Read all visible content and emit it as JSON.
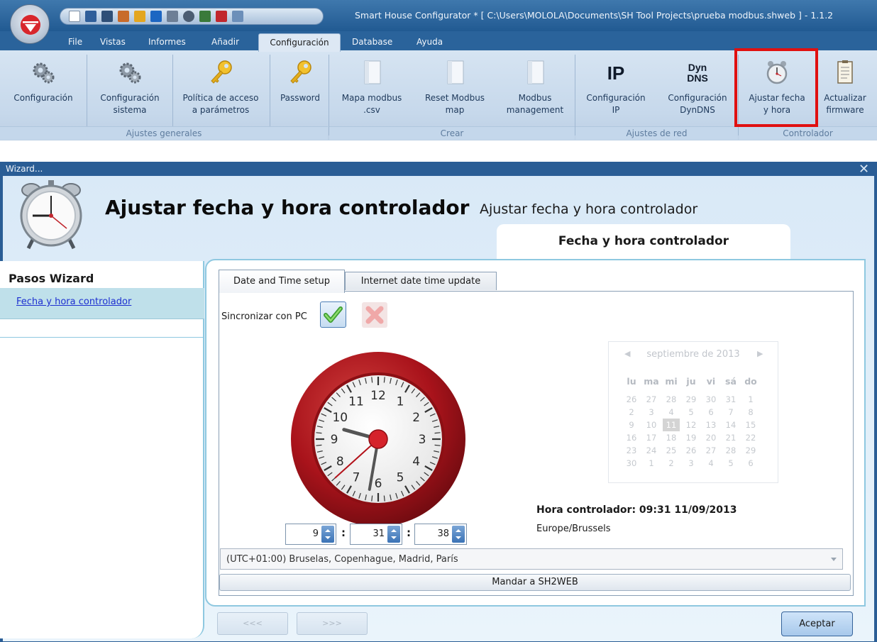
{
  "app": {
    "title": "Smart House Configurator * [ C:\\Users\\MOLOLA\\Documents\\SH Tool Projects\\prueba modbus.shweb ] - 1.1.2",
    "tabs": [
      "File",
      "Vistas",
      "Informes",
      "Añadir",
      "Configuración",
      "Database",
      "Ayuda"
    ],
    "active_tab": "Configuración"
  },
  "ribbon": {
    "items": [
      {
        "label1": "Configuración",
        "label2": "",
        "icon": "gears-icon"
      },
      {
        "label1": "Configuración",
        "label2": "sistema",
        "icon": "gears-icon"
      },
      {
        "label1": "Política de acceso",
        "label2": "a parámetros",
        "icon": "key-icon"
      },
      {
        "label1": "Password",
        "label2": "",
        "icon": "key-icon"
      },
      {
        "label1": "Mapa modbus",
        "label2": ".csv",
        "icon": "document-icon"
      },
      {
        "label1": "Reset Modbus",
        "label2": "map",
        "icon": "document-icon"
      },
      {
        "label1": "Modbus",
        "label2": "management",
        "icon": "document-icon"
      },
      {
        "label1": "Configuración",
        "label2": "IP",
        "icon": "ip-icon"
      },
      {
        "label1": "Configuración",
        "label2": "DynDNS",
        "icon": "dyndns-icon"
      },
      {
        "label1": "Ajustar fecha",
        "label2": "y hora",
        "icon": "alarm-clock-icon"
      },
      {
        "label1": "Actualizar",
        "label2": "firmware",
        "icon": "clipboard-icon"
      }
    ],
    "groups": [
      "Ajustes generales",
      "Crear",
      "Ajustes de red",
      "Controlador"
    ],
    "highlight_color": "#e01010"
  },
  "wizard": {
    "window_title": "Wizard...",
    "close": "✕",
    "heading": "Ajustar fecha y hora controlador",
    "subheading": "Ajustar fecha y hora controlador",
    "step_tab": "Fecha y hora controlador",
    "steps_title": "Pasos Wizard",
    "steps": [
      "Fecha y hora controlador"
    ],
    "tabs": [
      "Date and Time setup",
      "Internet date time update"
    ],
    "sync_label": "Sincronizar con PC",
    "clock": {
      "hour": 9,
      "minute": 31,
      "second": 38,
      "numerals": [
        "12",
        "1",
        "2",
        "3",
        "4",
        "5",
        "6",
        "7",
        "8",
        "9",
        "10",
        "11"
      ]
    },
    "time_fields": {
      "hour": "9",
      "minute": "31",
      "second": "38"
    },
    "calendar": {
      "month_label": "septiembre de 2013",
      "dow": [
        "lu",
        "ma",
        "mi",
        "ju",
        "vi",
        "sá",
        "do"
      ],
      "days": [
        [
          "26",
          "27",
          "28",
          "29",
          "30",
          "31",
          "1"
        ],
        [
          "2",
          "3",
          "4",
          "5",
          "6",
          "7",
          "8"
        ],
        [
          "9",
          "10",
          "11",
          "12",
          "13",
          "14",
          "15"
        ],
        [
          "16",
          "17",
          "18",
          "19",
          "20",
          "21",
          "22"
        ],
        [
          "23",
          "24",
          "25",
          "26",
          "27",
          "28",
          "29"
        ],
        [
          "30",
          "1",
          "2",
          "3",
          "4",
          "5",
          "6"
        ]
      ],
      "selected": "11"
    },
    "controller_time": "Hora controlador: 09:31  11/09/2013",
    "timezone_name": "Europe/Brussels",
    "timezone_select": "(UTC+01:00) Bruselas, Copenhague, Madrid, París",
    "send_button": "Mandar a SH2WEB",
    "prev_button": "<<<",
    "next_button": ">>>",
    "ok_button": "Aceptar"
  }
}
